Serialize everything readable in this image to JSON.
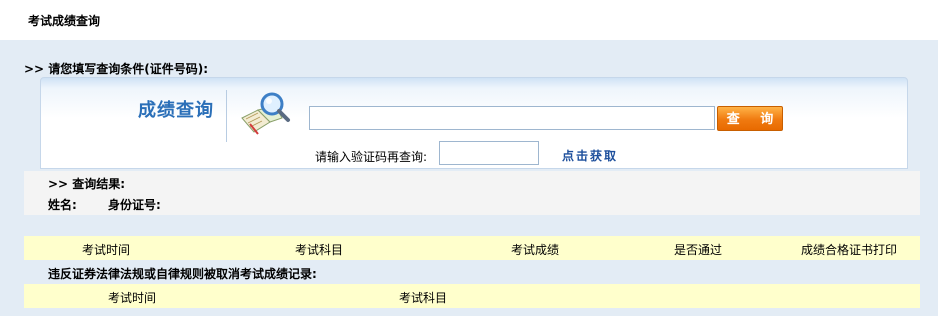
{
  "page": {
    "title": "考试成绩查询"
  },
  "query": {
    "prompt": ">>  请您填写查询条件(证件号码):",
    "brand": "成绩查询",
    "search_value": "",
    "search_button": "查 询",
    "captcha_label": "请输入验证码再查询:",
    "captcha_value": "",
    "captcha_link": "点击获取"
  },
  "result": {
    "heading": ">>  查询结果:",
    "name_label": "姓名:",
    "id_label": "身份证号:"
  },
  "score_table": {
    "columns": [
      "考试时间",
      "考试科目",
      "考试成绩",
      "是否通过",
      "成绩合格证书打印"
    ]
  },
  "violation": {
    "title": "违反证券法律法规或自律规则被取消考试成绩记录:",
    "columns": [
      "考试时间",
      "考试科目"
    ]
  },
  "colors": {
    "accent_orange": "#f07a10",
    "brand_blue": "#2a6fb8",
    "header_yellow": "#ffffcc",
    "background": "#e3ecf5"
  },
  "icons": [
    "magnifier-book-icon"
  ]
}
